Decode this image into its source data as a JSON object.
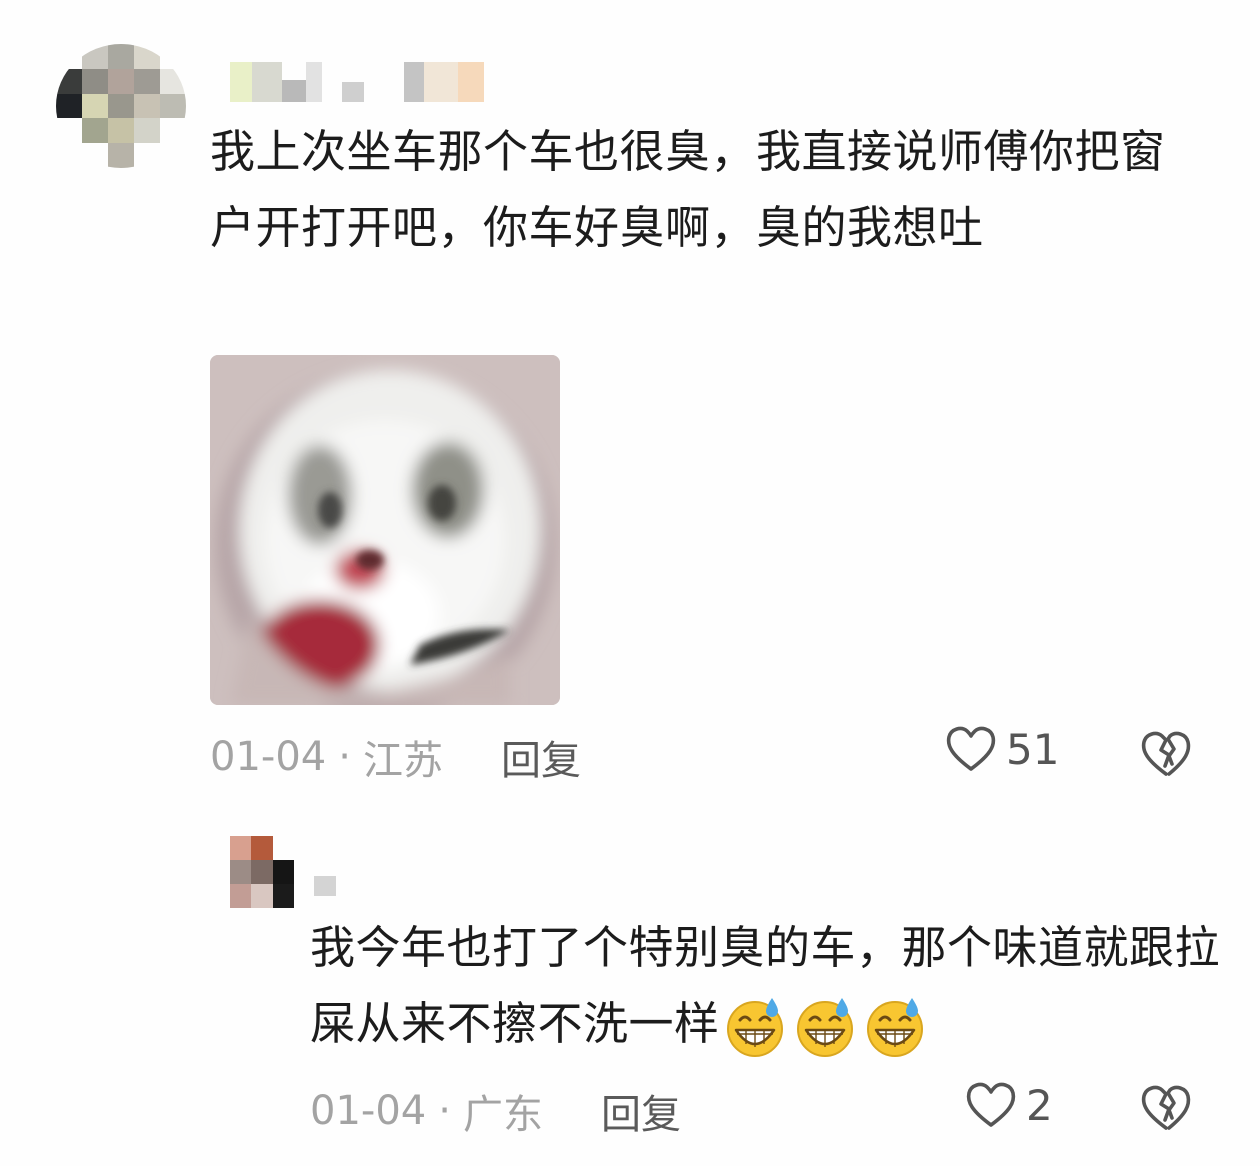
{
  "comments": [
    {
      "text": "我上次坐车那个车也很臭，我直接说师傅你把窗户开打开吧，你车好臭啊，臭的我想吐",
      "date": "01-04",
      "location": "江苏",
      "reply_label": "回复",
      "like_count": "51",
      "has_sticker": true
    }
  ],
  "reply": {
    "text": "我今年也打了个特别臭的车，那个味道就跟拉屎从来不擦不洗一样",
    "emojis": [
      "grin-sweat-emoji",
      "grin-sweat-emoji",
      "grin-sweat-emoji"
    ],
    "date": "01-04",
    "location": "广东",
    "reply_label": "回复",
    "like_count": "2"
  },
  "meta_separator": "·",
  "colors": {
    "text": "#1c1c1c",
    "meta": "#a3a3a3",
    "reply_action": "#5a5a5a",
    "icon": "#555555"
  }
}
